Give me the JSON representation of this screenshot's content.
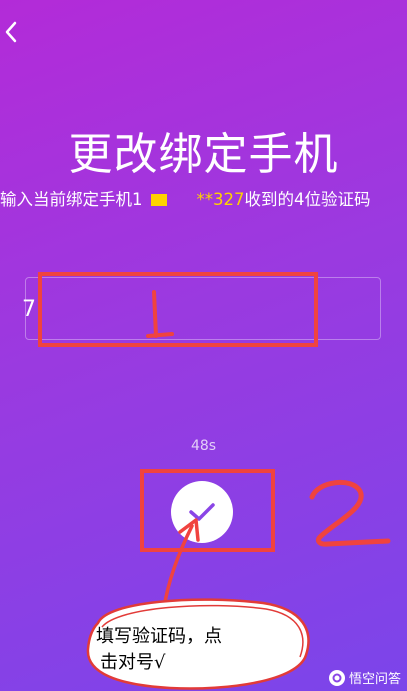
{
  "header": {
    "back_label": "<"
  },
  "page": {
    "title": "更改绑定手机",
    "subtitle_prefix": "输入当前绑定手机1",
    "subtitle_masked_digits": "**",
    "subtitle_tail_digits": "327",
    "subtitle_suffix": "收到的4位验证码"
  },
  "code_field": {
    "value": "7"
  },
  "timer": {
    "text": "48s"
  },
  "annotations": {
    "step1": "1",
    "step2": "2",
    "note_line1": "填写验证码，点",
    "note_line2": "击对号√"
  },
  "watermark": {
    "text": "悟空问答"
  },
  "colors": {
    "highlight": "#ffd200",
    "annotation": "#f0433f"
  }
}
